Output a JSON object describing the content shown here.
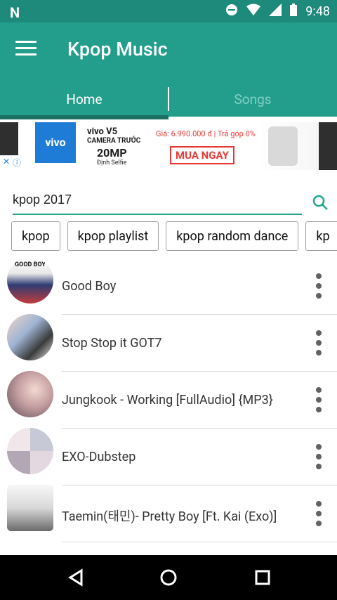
{
  "status": {
    "time": "9:48"
  },
  "app": {
    "title": "Kpop Music"
  },
  "tabs": [
    {
      "label": "Home",
      "active": true
    },
    {
      "label": "Songs",
      "active": false
    }
  ],
  "ad": {
    "brand": "vivo",
    "model": "vivo V5",
    "subtitle": "CAMERA TRƯỚC",
    "megapixels": "20MP",
    "caption": "Định Selfie",
    "price": "Giá: 6.990.000 đ | Trả góp 0%",
    "cta": "MUA NGAY"
  },
  "search": {
    "value": "kpop 2017"
  },
  "chips": [
    "kpop",
    "kpop playlist",
    "kpop random dance",
    "kp"
  ],
  "songs": [
    {
      "title": "Good Boy",
      "thumb_label": "GOOD BOY"
    },
    {
      "title": "Stop Stop it GOT7",
      "thumb_label": ""
    },
    {
      "title": "Jungkook - Working [FullAudio] {MP3}",
      "thumb_label": ""
    },
    {
      "title": "EXO-Dubstep",
      "thumb_label": ""
    },
    {
      "title": "Taemin(태민)- Pretty Boy [Ft. Kai (Exo)]",
      "thumb_label": ""
    }
  ],
  "colors": {
    "primary": "#239e8d",
    "primary_dark": "#1d8a7b",
    "tab_indicator": "#1b6f62",
    "navbar": "#000000"
  }
}
